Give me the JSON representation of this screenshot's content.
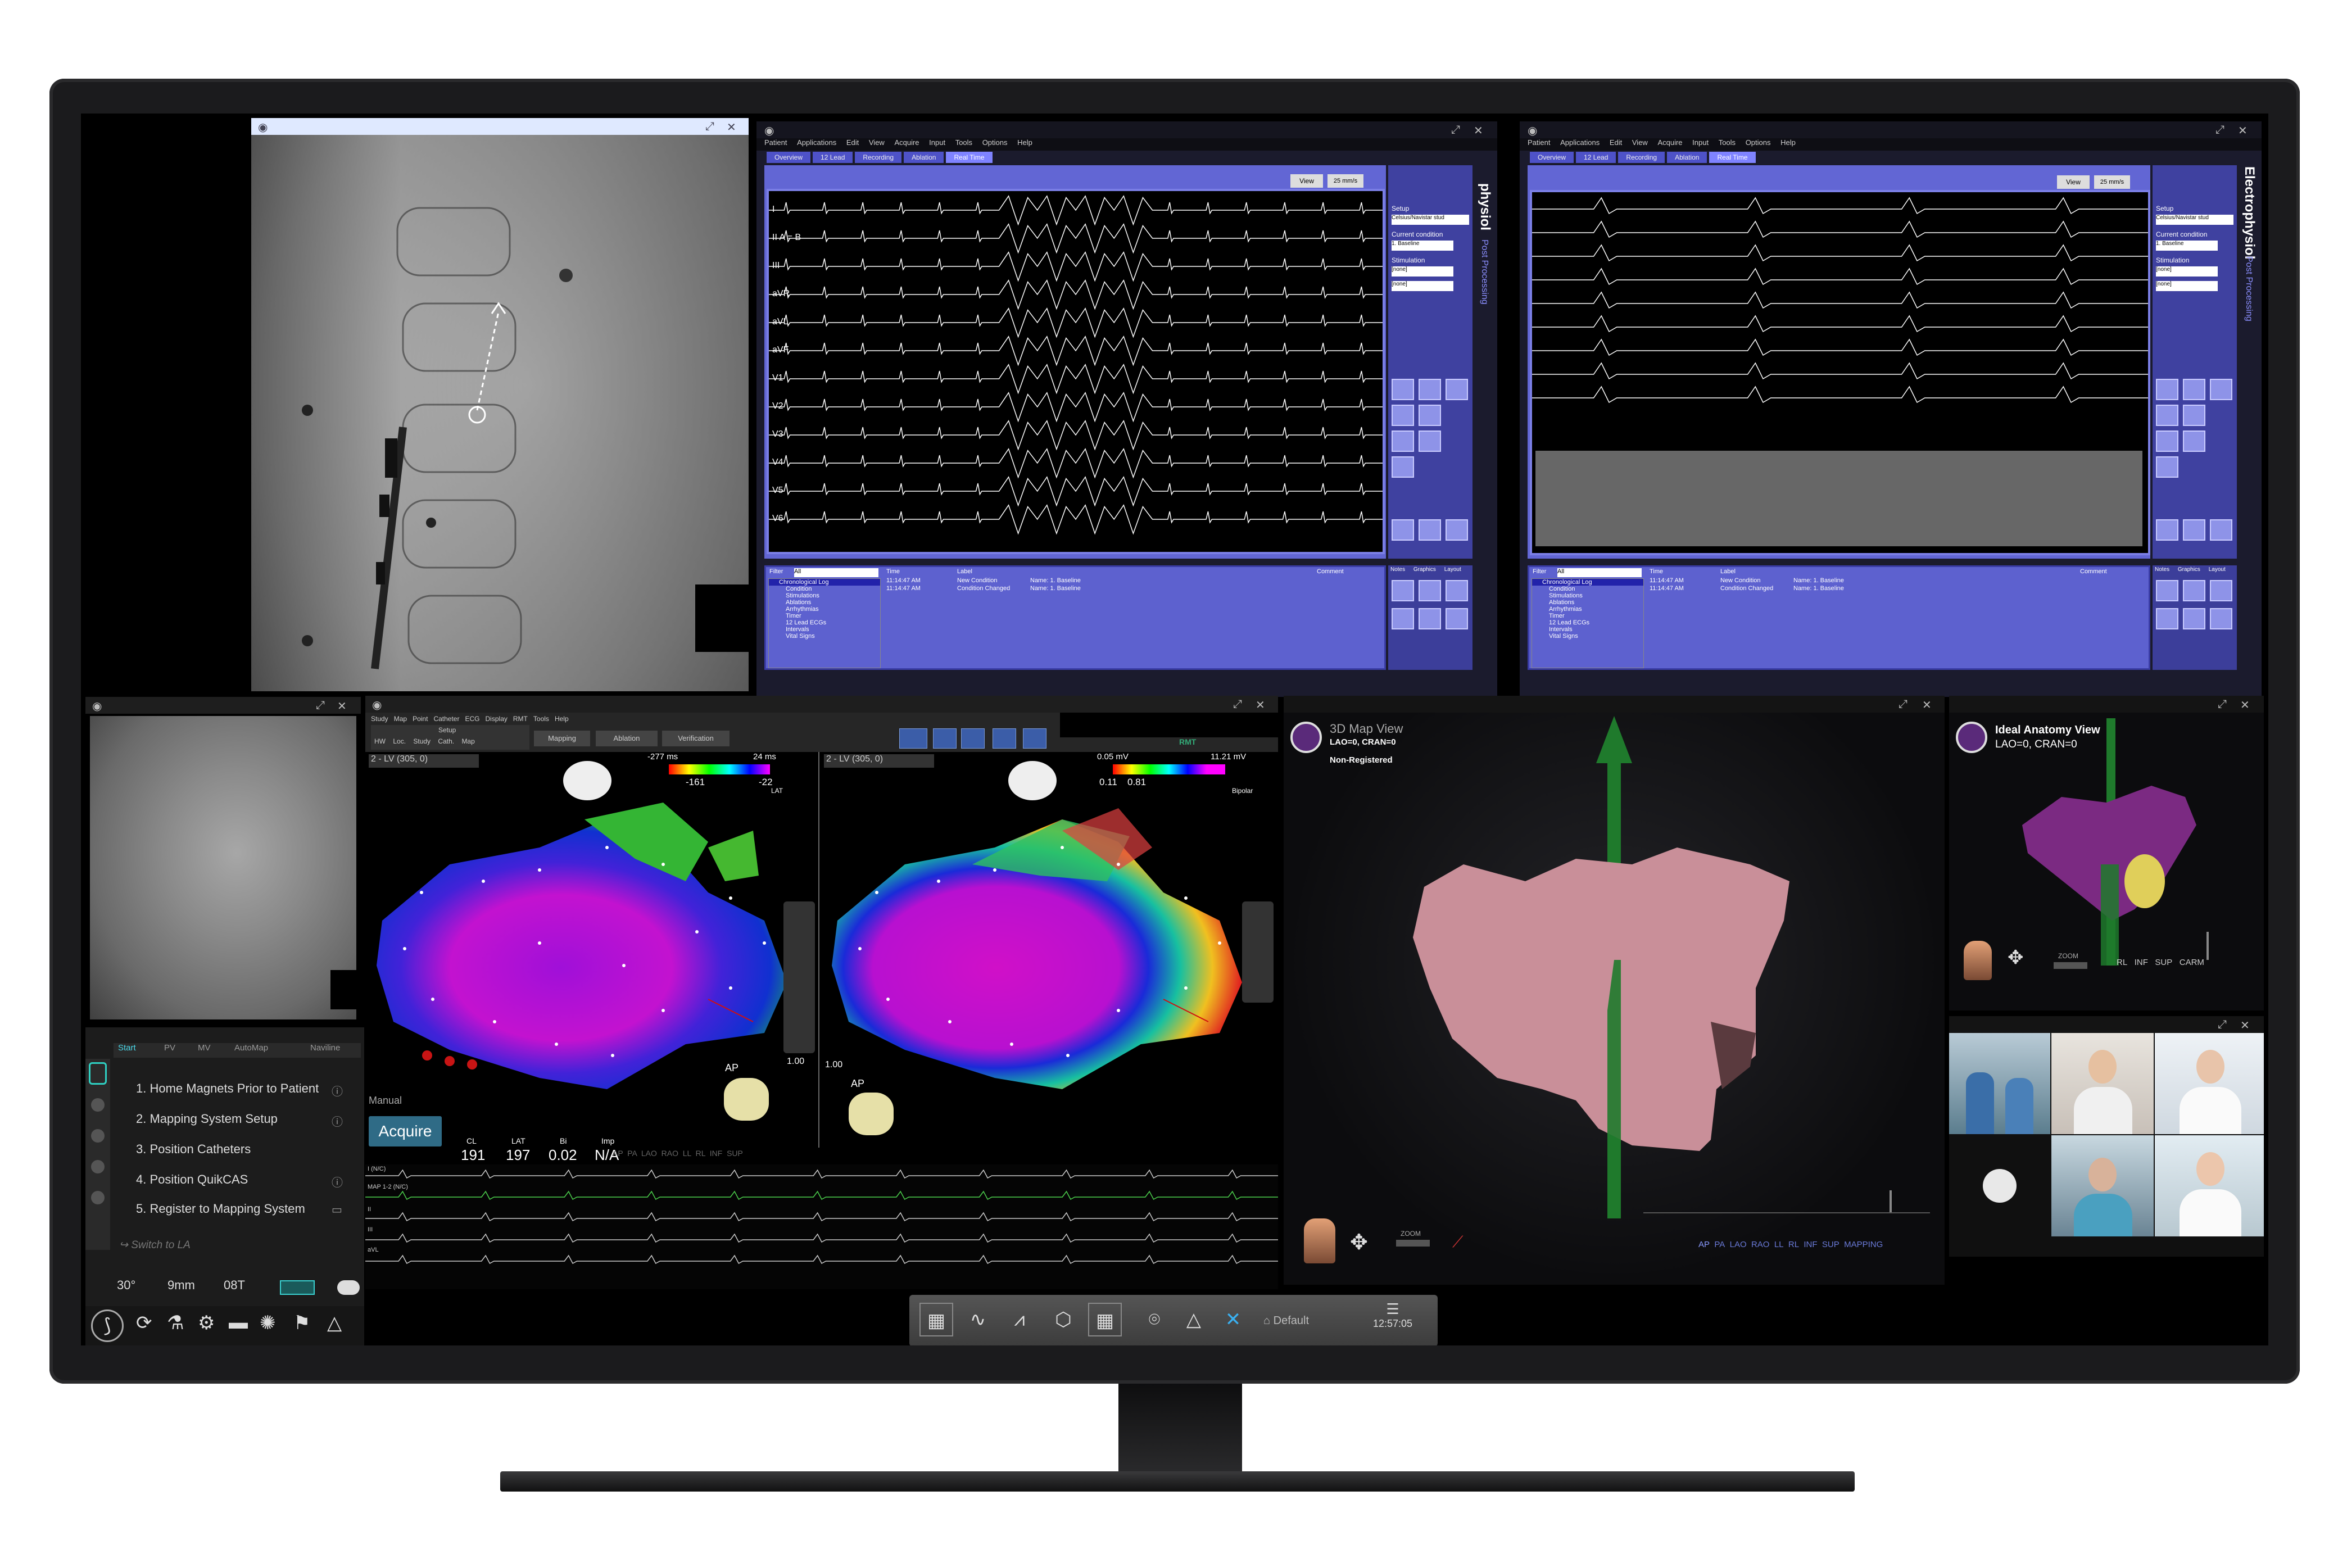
{
  "ep_left": {
    "menu": [
      "Patient",
      "Applications",
      "Edit",
      "View",
      "Acquire",
      "Input",
      "Tools",
      "Options",
      "Help"
    ],
    "tabs": [
      "Overview",
      "12 Lead",
      "Recording",
      "Ablation",
      "Real Time"
    ],
    "view_btn": "View",
    "speed": "25 mm/s",
    "leads": [
      "I",
      "II  A = B",
      "III",
      "aVR",
      "aVL",
      "aVF",
      "V1",
      "V2",
      "V3",
      "V4",
      "V5",
      "V6"
    ],
    "vertical_title": "physiol",
    "vertical_sub": "Post Processing",
    "setup_label": "Setup",
    "setup_value": "Celsius/Navistar stud",
    "condition_label": "Current condition",
    "condition_value": "1. Baseline",
    "stimulation_label": "Stimulation",
    "stim1": "[none]",
    "stim2": "[none]",
    "filter_label": "Filter",
    "filter_value": "All",
    "tree": [
      "Chronological Log",
      "Condition",
      "Stimulations",
      "Ablations",
      "Arrhythmias",
      "Timer",
      "12 Lead ECGs",
      "Intervals",
      "Vital Signs"
    ],
    "log_headers": [
      "Time",
      "Label",
      "Comment"
    ],
    "log_rows": [
      [
        "11:14:47 AM",
        "New Condition",
        "Name: 1. Baseline"
      ],
      [
        "11:14:47 AM",
        "Condition Changed",
        "Name: 1. Baseline"
      ]
    ],
    "side_tabs": [
      "Notes",
      "Graphics",
      "Layout"
    ]
  },
  "ep_right": {
    "menu": [
      "Patient",
      "Applications",
      "Edit",
      "View",
      "Acquire",
      "Input",
      "Tools",
      "Options",
      "Help"
    ],
    "tabs": [
      "Overview",
      "12 Lead",
      "Recording",
      "Ablation",
      "Real Time"
    ],
    "view_btn": "View",
    "speed": "25 mm/s",
    "vertical_title": "Electrophysiol",
    "vertical_sub": "Post Processing",
    "setup_label": "Setup",
    "setup_value": "Celsius/Navistar stud",
    "condition_label": "Current condition",
    "condition_value": "1. Baseline",
    "stimulation_label": "Stimulation",
    "stim1": "[none]",
    "stim2": "[none]",
    "filter_label": "Filter",
    "filter_value": "All",
    "tree": [
      "Chronological Log",
      "Condition",
      "Stimulations",
      "Ablations",
      "Arrhythmias",
      "Timer",
      "12 Lead ECGs",
      "Intervals",
      "Vital Signs"
    ],
    "log_headers": [
      "Time",
      "Label",
      "Comment"
    ],
    "log_rows": [
      [
        "11:14:47 AM",
        "New Condition",
        "Name: 1. Baseline"
      ],
      [
        "11:14:47 AM",
        "Condition Changed",
        "Name: 1. Baseline"
      ]
    ],
    "side_tabs": [
      "Notes",
      "Graphics",
      "Layout"
    ]
  },
  "mapping": {
    "menu": [
      "Study",
      "Map",
      "Point",
      "Catheter",
      "ECG",
      "Display",
      "RMT",
      "Tools",
      "Help"
    ],
    "sub_menu": [
      "HW",
      "Loc.",
      "Study",
      "Cath.",
      "Map"
    ],
    "setup_label": "Setup",
    "workflow": [
      "Mapping",
      "Ablation",
      "Verification"
    ],
    "rmt_label": "RMT",
    "left_map": {
      "selector": "2 - LV (305, 0)",
      "scale_min": "-277 ms",
      "scale_max": "24 ms",
      "val_a": "-161",
      "val_b": "-22",
      "unit": "LAT"
    },
    "right_map": {
      "selector": "2 - LV (305, 0)",
      "scale_min": "0.05 mV",
      "scale_max": "11.21 mV",
      "val_a": "0.11",
      "val_b": "0.81",
      "unit": "Bipolar"
    },
    "slider_left": "1.00",
    "slider_right": "1.00",
    "mode": "Manual",
    "acquire": "Acquire",
    "readout_labels": [
      "CL",
      "LAT",
      "Bi",
      "Imp"
    ],
    "readout_values": [
      "191",
      "197",
      "0.02",
      "N/A"
    ],
    "views": "AP  PA  LAO  RAO  LL  RL  INF  SUP",
    "ap_label": "AP",
    "signals": [
      "I (N/C)",
      "MAP 1-2 (N/C)",
      "II",
      "III",
      "aVL"
    ]
  },
  "workflow_panel": {
    "tabs": [
      "Start",
      "PV",
      "MV",
      "AutoMap",
      "Naviline"
    ],
    "steps": [
      "1.  Home Magnets Prior to Patient",
      "2.  Mapping System Setup",
      "3.  Position Catheters",
      "4.  Position QuikCAS",
      "5.  Register to Mapping System"
    ],
    "switch": "Switch to LA",
    "bottom_values": [
      "30°",
      "9mm",
      "08T"
    ]
  },
  "map3d": {
    "title": "3D Map View",
    "orientation": "LAO=0, CRAN=0",
    "status": "Non-Registered",
    "zoom": "ZOOM",
    "views": [
      "AP",
      "PA",
      "LAO",
      "RAO",
      "LL",
      "RL",
      "INF",
      "SUP",
      "MAPPING"
    ]
  },
  "ideal": {
    "title": "Ideal Anatomy View",
    "orientation": "LAO=0, CRAN=0",
    "zoom": "ZOOM",
    "views": [
      "RL",
      "INF",
      "SUP",
      "CARM"
    ]
  },
  "toolbar": {
    "default_label": "Default",
    "time": "12:57:05"
  },
  "colors": {
    "ep_purple": "#5d61cf",
    "ep_border": "#7b7fe6",
    "tissue_pink": "#c9909a",
    "anatomy_purple": "#7b2a82",
    "axis_green": "#1f7a2c"
  }
}
